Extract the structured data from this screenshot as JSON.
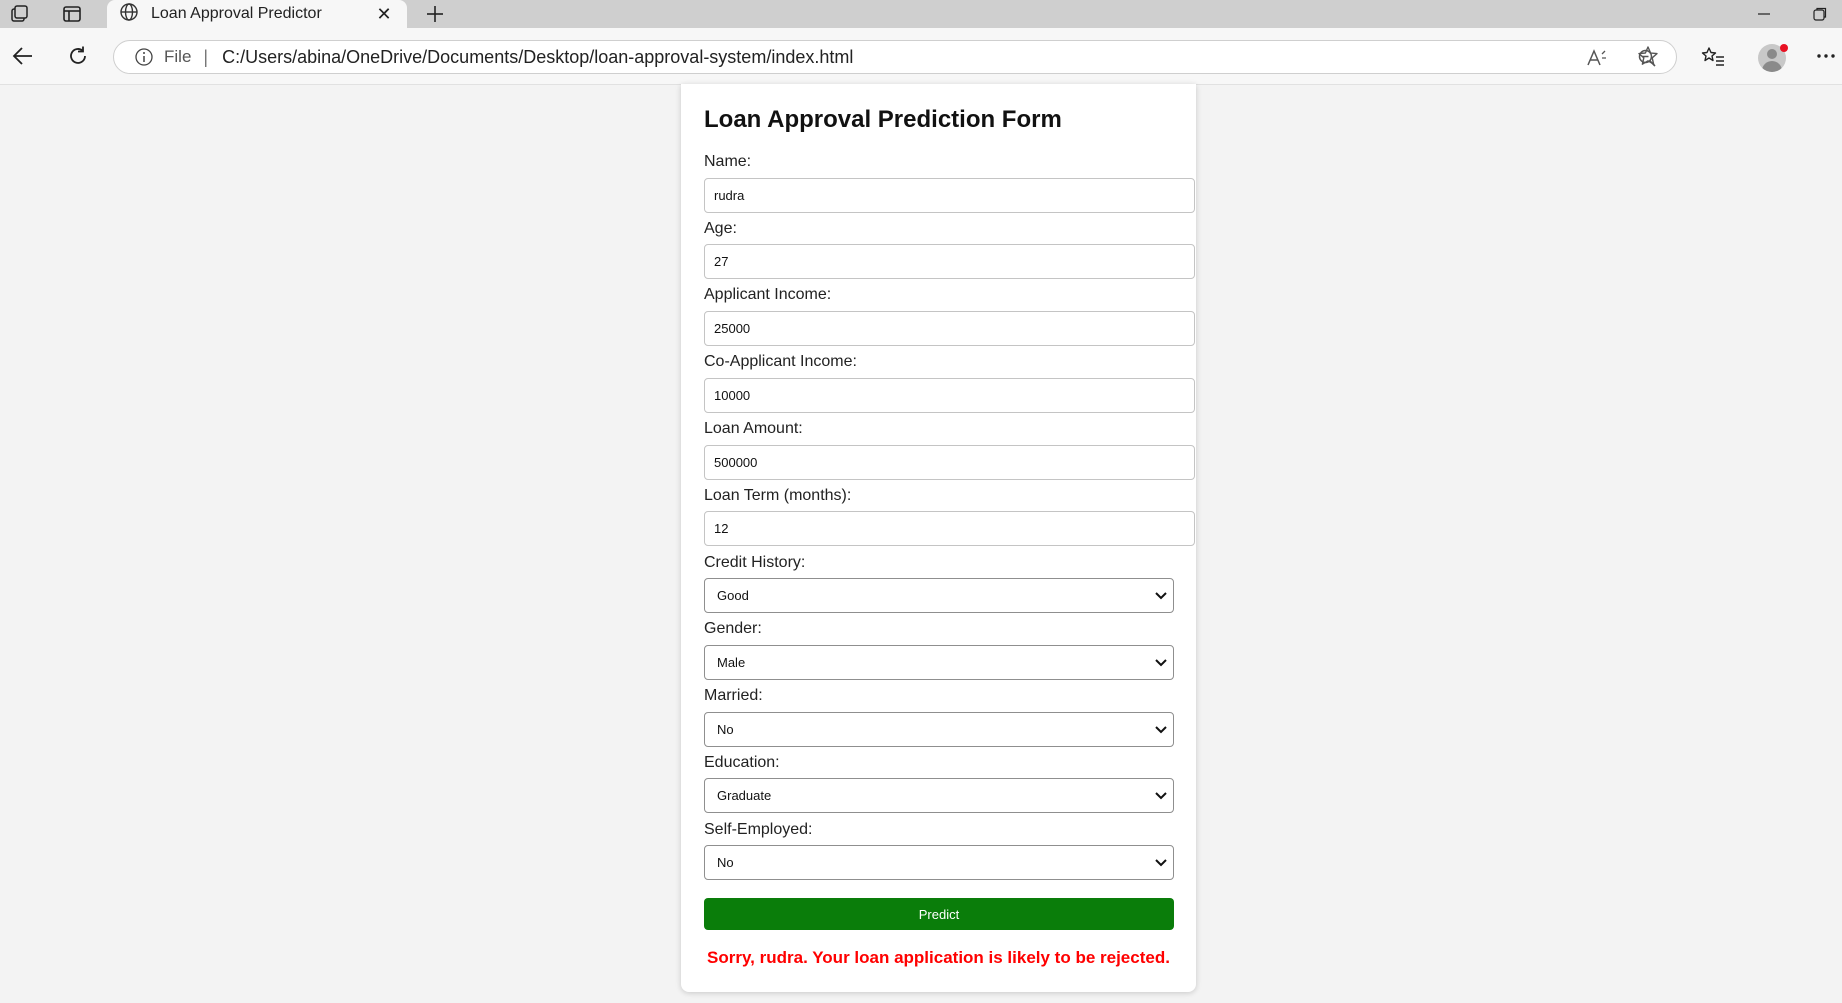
{
  "browser": {
    "tab_title": "Loan Approval Predictor",
    "address_prefix": "File",
    "url": "C:/Users/abina/OneDrive/Documents/Desktop/loan-approval-system/index.html"
  },
  "form": {
    "title": "Loan Approval Prediction Form",
    "fields": {
      "name": {
        "label": "Name:",
        "value": "rudra"
      },
      "age": {
        "label": "Age:",
        "value": "27"
      },
      "applicant_income": {
        "label": "Applicant Income:",
        "value": "25000"
      },
      "coapplicant_income": {
        "label": "Co-Applicant Income:",
        "value": "10000"
      },
      "loan_amount": {
        "label": "Loan Amount:",
        "value": "500000"
      },
      "loan_term": {
        "label": "Loan Term (months):",
        "value": "12"
      }
    },
    "selects": {
      "credit_history": {
        "label": "Credit History:",
        "value": "Good"
      },
      "gender": {
        "label": "Gender:",
        "value": "Male"
      },
      "married": {
        "label": "Married:",
        "value": "No"
      },
      "education": {
        "label": "Education:",
        "value": "Graduate"
      },
      "self_employed": {
        "label": "Self-Employed:",
        "value": "No"
      }
    },
    "submit_label": "Predict",
    "result_text": "Sorry, rudra. Your loan application is likely to be rejected.",
    "result_color": "#ff0000",
    "button_color": "#0a7d0a"
  }
}
